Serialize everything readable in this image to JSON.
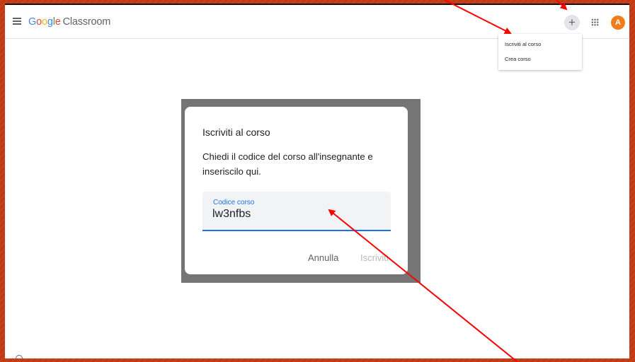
{
  "app": {
    "logo_letters": [
      "G",
      "o",
      "o",
      "g",
      "l",
      "e"
    ],
    "product_name": "Classroom"
  },
  "header": {
    "menu_icon": "hamburger-menu-icon",
    "add_icon": "plus-icon",
    "add_label": "+",
    "apps_icon": "apps-grid-icon",
    "avatar_initial": "A"
  },
  "dropdown": {
    "items": [
      {
        "label": "Iscriviti al corso"
      },
      {
        "label": "Crea corso"
      }
    ]
  },
  "dialog": {
    "title": "Iscriviti al corso",
    "description": "Chiedi il codice del corso all'insegnante e inseriscilo qui.",
    "field_label": "Codice corso",
    "field_value": "lw3nfbs",
    "cancel_label": "Annulla",
    "join_label": "Iscriviti"
  },
  "colors": {
    "accent": "#1a73e8",
    "annotation": "#ff0000",
    "avatar": "#ef7d1d",
    "border": "#c8401a"
  }
}
